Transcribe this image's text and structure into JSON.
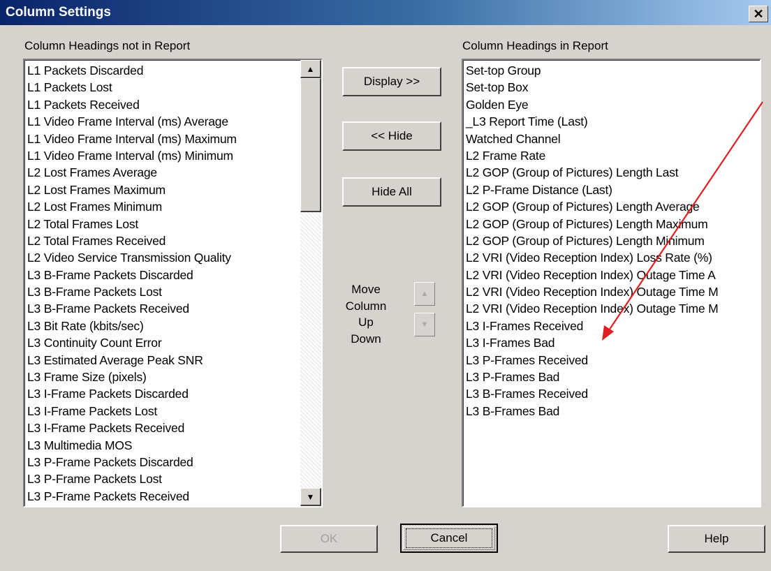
{
  "window": {
    "title": "Column Settings",
    "close_glyph": "✕"
  },
  "left_panel": {
    "label": "Column Headings not in Report",
    "items": [
      "L1 Packets Discarded",
      "L1 Packets Lost",
      "L1 Packets Received",
      "L1 Video Frame Interval (ms) Average",
      "L1 Video Frame Interval (ms) Maximum",
      "L1 Video Frame Interval (ms) Minimum",
      "L2 Lost Frames Average",
      "L2 Lost Frames Maximum",
      "L2 Lost Frames Minimum",
      "L2 Total Frames Lost",
      "L2 Total Frames Received",
      "L2 Video Service Transmission Quality",
      "L3 B-Frame Packets Discarded",
      "L3 B-Frame Packets Lost",
      "L3 B-Frame Packets Received",
      "L3 Bit Rate (kbits/sec)",
      "L3 Continuity Count Error",
      "L3 Estimated Average Peak SNR",
      "L3 Frame Size (pixels)",
      "L3 I-Frame Packets Discarded",
      "L3 I-Frame Packets Lost",
      "L3 I-Frame Packets Received",
      "L3 Multimedia MOS",
      "L3 P-Frame Packets Discarded",
      "L3 P-Frame Packets Lost",
      "L3 P-Frame Packets Received"
    ]
  },
  "right_panel": {
    "label": "Column Headings in Report",
    "items": [
      "Set-top Group",
      "Set-top Box",
      "Golden Eye",
      "_L3 Report Time (Last)",
      "Watched Channel",
      "L2 Frame Rate",
      "L2 GOP (Group of Pictures) Length Last",
      "L2 P-Frame Distance (Last)",
      "L2 GOP (Group of Pictures) Length Average",
      "L2 GOP (Group of Pictures) Length Maximum",
      "L2 GOP (Group of Pictures) Length Minimum",
      "L2 VRI (Video Reception Index) Loss Rate (%)",
      "L2 VRI (Video Reception Index) Outage Time A",
      "L2 VRI (Video Reception Index) Outage Time M",
      "L2 VRI (Video Reception Index) Outage Time M",
      "L3 I-Frames Received",
      "L3 I-Frames Bad",
      "L3 P-Frames Received",
      "L3 P-Frames Bad",
      "L3 B-Frames Received",
      "L3 B-Frames Bad"
    ]
  },
  "middle": {
    "display_label": "Display >>",
    "hide_label": "<< Hide",
    "hide_all_label": "Hide All",
    "move_line1": "Move",
    "move_line2": "Column",
    "move_line3": "Up",
    "move_line4": "Down",
    "up_glyph": "▲",
    "down_glyph": "▼"
  },
  "footer": {
    "ok_label": "OK",
    "cancel_label": "Cancel",
    "help_label": "Help"
  },
  "scroll": {
    "up_glyph": "▲",
    "down_glyph": "▼"
  },
  "annotation": {
    "arrow_color": "#e02020"
  }
}
